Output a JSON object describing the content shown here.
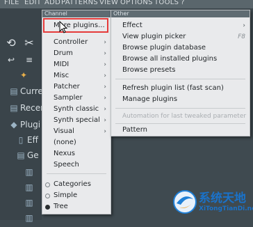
{
  "menubar": {
    "items": [
      "FILE",
      "EDIT",
      "ADD",
      "PATTERNS",
      "VIEW",
      "OPTIONS",
      "TOOLS",
      "?"
    ]
  },
  "browser": {
    "items": [
      {
        "label": "Curre",
        "icon": "folder-icon"
      },
      {
        "label": "Recen",
        "icon": "folder-icon"
      },
      {
        "label": "Plugi",
        "icon": "plugin-icon"
      },
      {
        "label": "Eff",
        "icon": "file-icon"
      },
      {
        "label": "Ge",
        "icon": "folder-icon"
      },
      {
        "label": "",
        "icon": "plugin-item-icon"
      },
      {
        "label": "",
        "icon": "plugin-item-icon"
      },
      {
        "label": "",
        "icon": "plugin-item-icon"
      },
      {
        "label": "",
        "icon": "plugin-item-icon"
      }
    ]
  },
  "channel_menu": {
    "header": "Channel",
    "items": [
      {
        "label": "More plugins...",
        "arrow": false
      },
      {
        "label": "Controller",
        "arrow": true
      },
      {
        "label": "Drum",
        "arrow": true
      },
      {
        "label": "MIDI",
        "arrow": true
      },
      {
        "label": "Misc",
        "arrow": true
      },
      {
        "label": "Patcher",
        "arrow": true
      },
      {
        "label": "Sampler",
        "arrow": true
      },
      {
        "label": "Synth classic",
        "arrow": true
      },
      {
        "label": "Synth special",
        "arrow": true
      },
      {
        "label": "Visual",
        "arrow": true
      },
      {
        "label": "(none)",
        "arrow": false
      },
      {
        "label": "Nexus",
        "arrow": false
      },
      {
        "label": "Speech",
        "arrow": false
      }
    ],
    "view_options": [
      {
        "label": "Categories",
        "selected": false
      },
      {
        "label": "Simple",
        "selected": false
      },
      {
        "label": "Tree",
        "selected": true
      }
    ]
  },
  "other_menu": {
    "header": "Other",
    "items": [
      {
        "label": "Effect",
        "arrow": true,
        "shortcut": ""
      },
      {
        "label": "View plugin picker",
        "arrow": false,
        "shortcut": "F8"
      },
      {
        "label": "Browse plugin database",
        "arrow": false,
        "shortcut": ""
      },
      {
        "label": "Browse all installed plugins",
        "arrow": false,
        "shortcut": ""
      },
      {
        "label": "Browse presets",
        "arrow": false,
        "shortcut": ""
      },
      {
        "label": "Refresh plugin list (fast scan)",
        "arrow": false,
        "shortcut": ""
      },
      {
        "label": "Manage plugins",
        "arrow": false,
        "shortcut": ""
      },
      {
        "label": "Automation for last tweaked parameter",
        "arrow": false,
        "shortcut": "",
        "disabled": true
      },
      {
        "label": "Pattern",
        "arrow": false,
        "shortcut": ""
      }
    ]
  },
  "watermark": {
    "title": "系统天地",
    "url": "XiTongTianDi.net"
  }
}
